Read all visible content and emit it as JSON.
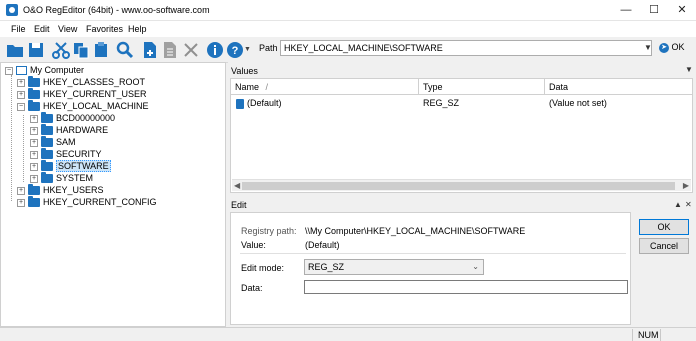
{
  "window": {
    "title": "O&O RegEditor (64bit) - www.oo-software.com"
  },
  "menu": [
    "File",
    "Edit",
    "View",
    "Favorites",
    "Help"
  ],
  "toolbar": {
    "path_label": "Path",
    "path_value": "HKEY_LOCAL_MACHINE\\SOFTWARE",
    "ok_label": "OK"
  },
  "tree": {
    "root": "My Computer",
    "items": [
      {
        "label": "HKEY_CLASSES_ROOT"
      },
      {
        "label": "HKEY_CURRENT_USER"
      },
      {
        "label": "HKEY_LOCAL_MACHINE"
      },
      {
        "label": "BCD00000000"
      },
      {
        "label": "HARDWARE"
      },
      {
        "label": "SAM"
      },
      {
        "label": "SECURITY"
      },
      {
        "label": "SOFTWARE"
      },
      {
        "label": "SYSTEM"
      },
      {
        "label": "HKEY_USERS"
      },
      {
        "label": "HKEY_CURRENT_CONFIG"
      }
    ]
  },
  "values": {
    "title": "Values",
    "columns": [
      "Name",
      "Type",
      "Data"
    ],
    "rows": [
      {
        "name": "(Default)",
        "type": "REG_SZ",
        "data": "(Value not set)"
      }
    ]
  },
  "edit": {
    "title": "Edit",
    "registry_path_label": "Registry path:",
    "registry_path_value": "\\\\My Computer\\HKEY_LOCAL_MACHINE\\SOFTWARE",
    "value_label": "Value:",
    "value_value": "(Default)",
    "edit_mode_label": "Edit mode:",
    "edit_mode_value": "REG_SZ",
    "data_label": "Data:",
    "data_value": "",
    "ok_button": "OK",
    "cancel_button": "Cancel"
  },
  "status": {
    "num": "NUM"
  },
  "colors": {
    "accent": "#1e73be",
    "selection": "#cce4f7"
  }
}
